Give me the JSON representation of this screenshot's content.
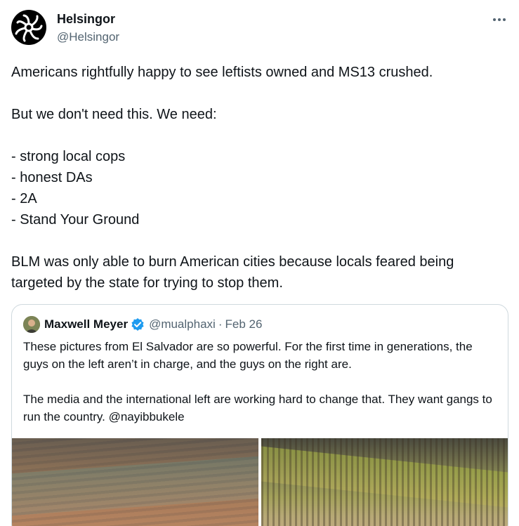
{
  "tweet": {
    "author_name": "Helsingor",
    "author_handle": "@Helsingor",
    "lines": [
      "Americans rightfully happy to see leftists owned and MS13 crushed.",
      "",
      "But we don't need this.  We need:",
      "",
      "- strong local cops",
      "- honest DAs",
      "- 2A",
      "- Stand Your Ground",
      "",
      "BLM was only able to burn American cities because locals feared being targeted by the state for trying to stop them."
    ],
    "more_icon": "more-horizontal-icon"
  },
  "quote": {
    "author_name": "Maxwell Meyer",
    "author_handle": "@mualphaxi",
    "separator": "·",
    "date": "Feb 26",
    "verified_icon": "verified-badge-icon",
    "paragraph1": "These pictures from El Salvador are so powerful. For the first time in generations, the guys on the left aren’t in charge, and the guys on the right are.",
    "paragraph2": "The media and the international left are working hard to change that. They want gangs to run the country. @nayibbukele",
    "images": [
      "prison-inmates-photo",
      "soldiers-formation-photo"
    ]
  },
  "colors": {
    "text": "#0f1419",
    "secondary": "#536471",
    "border": "#cfd9de",
    "verified": "#1d9bf0"
  }
}
